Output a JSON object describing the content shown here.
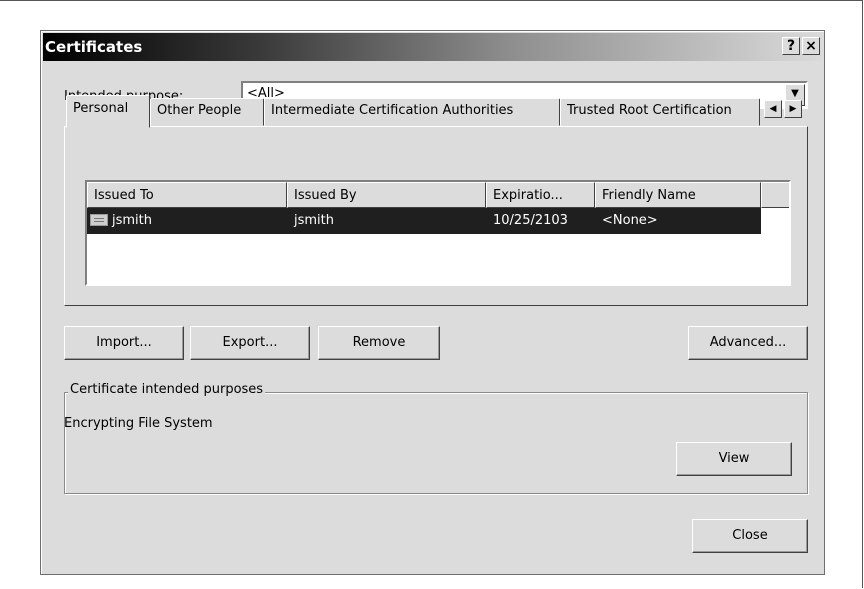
{
  "window": {
    "title": "Certificates",
    "help_button": "?",
    "close_button": "×"
  },
  "purpose": {
    "label": "Intended purpose:",
    "value": "<All>"
  },
  "tabs": [
    {
      "label": "Personal"
    },
    {
      "label": "Other People"
    },
    {
      "label": "Intermediate Certification Authorities"
    },
    {
      "label": "Trusted Root Certification"
    }
  ],
  "tab_scroll": {
    "left": "◀",
    "right": "▶"
  },
  "list": {
    "columns": [
      "Issued To",
      "Issued By",
      "Expiratio...",
      "Friendly Name"
    ],
    "rows": [
      {
        "issued_to": "jsmith",
        "issued_by": "jsmith",
        "expiration": "10/25/2103",
        "friendly_name": "<None>",
        "selected": true
      }
    ]
  },
  "buttons": {
    "import": "Import...",
    "export": "Export...",
    "remove": "Remove",
    "advanced": "Advanced...",
    "view": "View",
    "close": "Close"
  },
  "purposes_group": {
    "legend": "Certificate intended purposes",
    "text": "Encrypting File System"
  }
}
